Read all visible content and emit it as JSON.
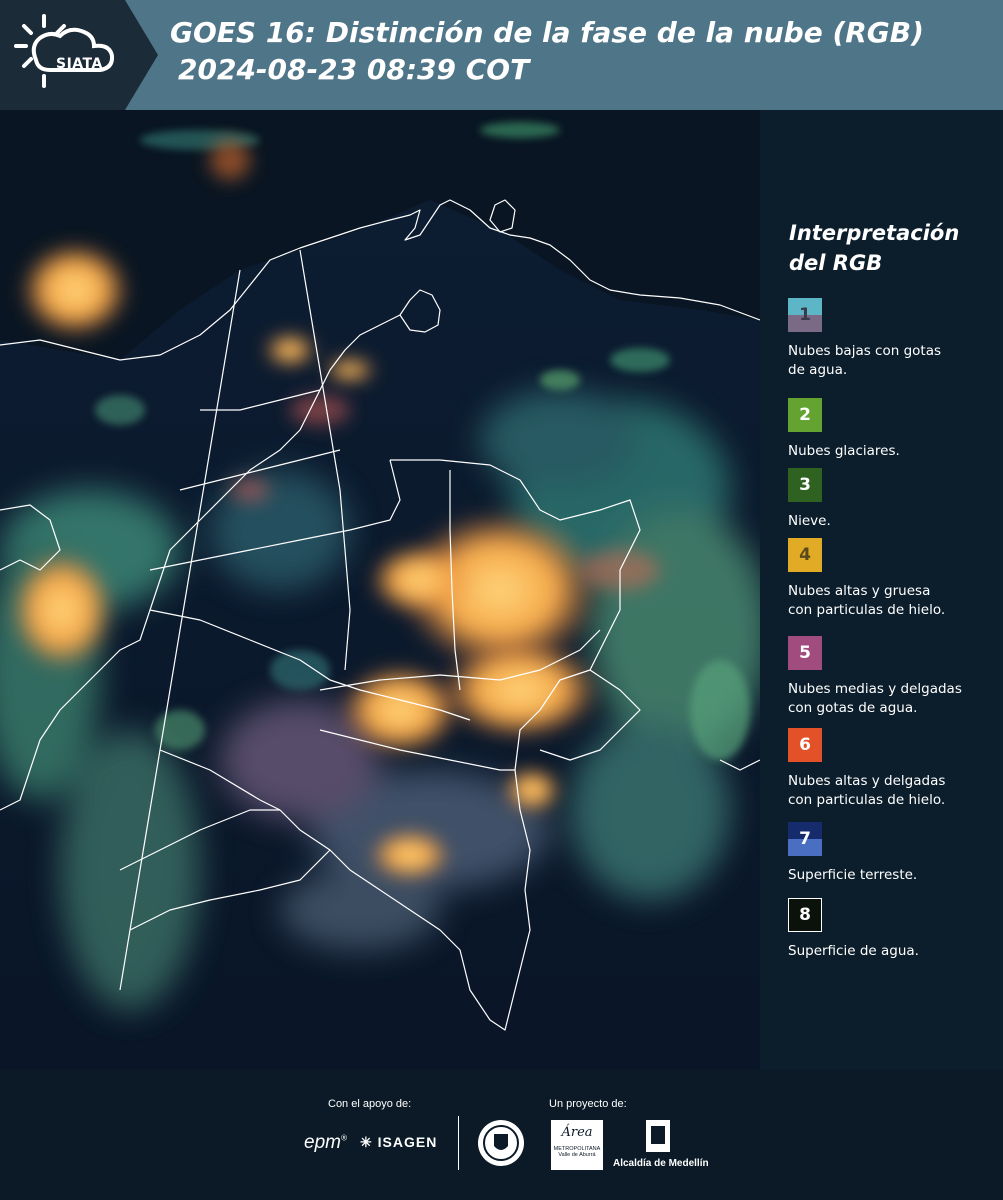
{
  "header": {
    "logo_text": "SIATA",
    "title_line1": "GOES 16: Distinción de la fase de la nube (RGB)",
    "title_line2": "2024-08-23 08:39 COT"
  },
  "legend": {
    "title_line1": "Interpretación",
    "title_line2": "del RGB",
    "items": [
      {
        "number": "1",
        "label_line1": "Nubes bajas con gotas",
        "label_line2": "de agua.",
        "color_top": "#5db6c6",
        "color_bottom": "#7b6a85",
        "text_color": "#3a3a4a"
      },
      {
        "number": "2",
        "label_line1": "Nubes glaciares.",
        "label_line2": "",
        "color_top": "#64a331",
        "color_bottom": "#64a331",
        "text_color": "#ffffff"
      },
      {
        "number": "3",
        "label_line1": "Nieve.",
        "label_line2": "",
        "color_top": "#2f6121",
        "color_bottom": "#2f6121",
        "text_color": "#ffffff"
      },
      {
        "number": "4",
        "label_line1": "Nubes altas y gruesa",
        "label_line2": "con particulas de hielo.",
        "color_top": "#e2ab25",
        "color_bottom": "#e2ab25",
        "text_color": "#5a4a1a"
      },
      {
        "number": "5",
        "label_line1": "Nubes medias y delgadas",
        "label_line2": "con gotas de agua.",
        "color_top": "#a04c7f",
        "color_bottom": "#a04c7f",
        "text_color": "#ffffff"
      },
      {
        "number": "6",
        "label_line1": "Nubes altas y delgadas",
        "label_line2": "con particulas de hielo.",
        "color_top": "#e25128",
        "color_bottom": "#e25128",
        "text_color": "#ffffff"
      },
      {
        "number": "7",
        "label_line1": "Superficie terreste.",
        "label_line2": "",
        "color_top": "#152b6b",
        "color_bottom": "#4a6fc2",
        "text_color": "#ffffff"
      },
      {
        "number": "8",
        "label_line1": "Superficie de agua.",
        "label_line2": "",
        "color_top": "#0a120b",
        "color_bottom": "#0a120b",
        "text_color": "#ffffff",
        "border": "#ffffff"
      }
    ]
  },
  "footer": {
    "support_caption": "Con el apoyo de:",
    "project_caption": "Un proyecto de:",
    "epm": "epm",
    "isagen": "ISAGEN",
    "area_line1": "Área",
    "area_line2": "METROPOLITANA",
    "area_line3": "Valle de Aburrá",
    "alcaldia": "Alcaldía de Medellín"
  }
}
